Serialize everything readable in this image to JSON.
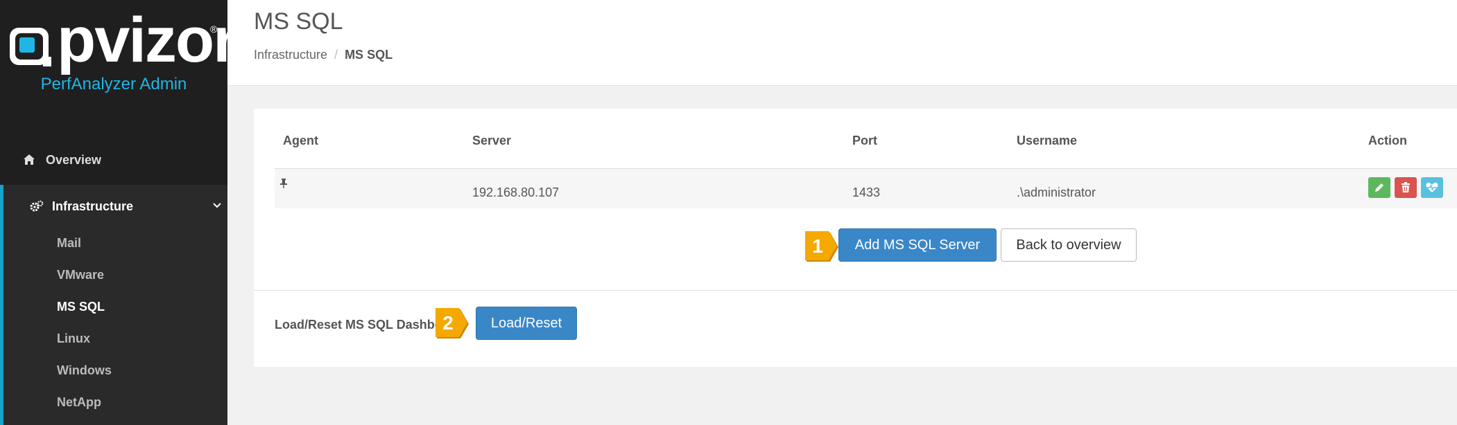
{
  "brand": {
    "logo_text": "pvizor",
    "registered": "®",
    "subtitle": "PerfAnalyzer Admin",
    "accent": "#1fb6e6"
  },
  "sidebar": {
    "overview": {
      "label": "Overview",
      "icon": "home-icon"
    },
    "infrastructure": {
      "label": "Infrastructure",
      "icon": "cogs-icon",
      "chevron": "chevron-down-icon"
    },
    "items": [
      {
        "label": "Mail",
        "active": false
      },
      {
        "label": "VMware",
        "active": false
      },
      {
        "label": "MS SQL",
        "active": true
      },
      {
        "label": "Linux",
        "active": false
      },
      {
        "label": "Windows",
        "active": false
      },
      {
        "label": "NetApp",
        "active": false
      }
    ]
  },
  "header": {
    "title": "MS SQL",
    "breadcrumb": {
      "parent": "Infrastructure",
      "separator": "/",
      "current": "MS SQL"
    }
  },
  "table": {
    "columns": [
      "Agent",
      "Server",
      "Port",
      "Username",
      "Action"
    ],
    "rows": [
      {
        "agent_icon": "pin-icon",
        "server": "192.168.80.107",
        "port": "1433",
        "username": ".\\administrator"
      }
    ],
    "actions": [
      {
        "name": "edit",
        "icon": "pencil-icon",
        "color": "#5cb85c"
      },
      {
        "name": "delete",
        "icon": "trash-icon",
        "color": "#d9534f"
      },
      {
        "name": "health",
        "icon": "heartbeat-icon",
        "color": "#5bc0de"
      }
    ]
  },
  "buttons": {
    "add": "Add MS SQL Server",
    "back": "Back to overview",
    "load_reset": "Load/Reset"
  },
  "load_section": {
    "label": "Load/Reset MS SQL Dashbo"
  },
  "markers": [
    {
      "number": "1",
      "color": "#f5a800"
    },
    {
      "number": "2",
      "color": "#f5a800"
    }
  ]
}
